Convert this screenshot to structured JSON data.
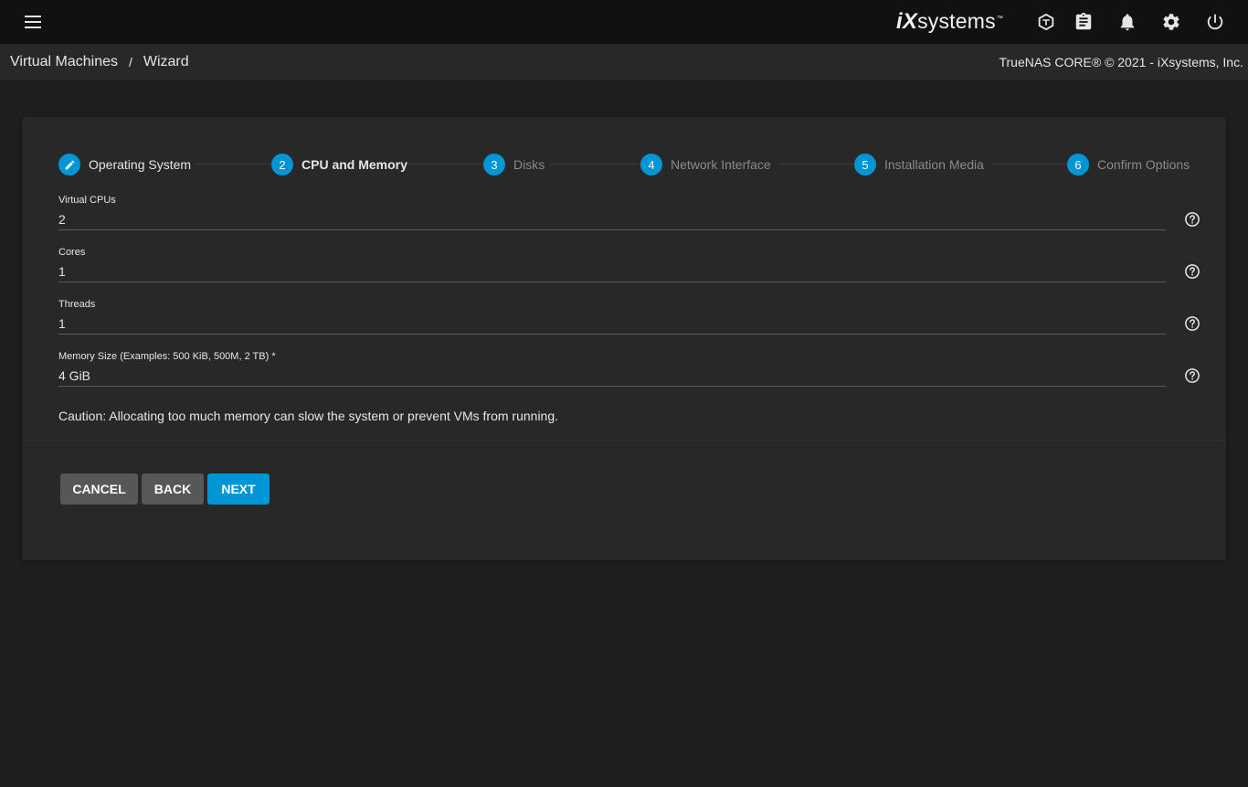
{
  "topbar": {
    "logo_ix": "iX",
    "logo_rest": "systems",
    "logo_tm": "™",
    "icons": [
      "truecommand-icon",
      "clipboard-icon",
      "bell-icon",
      "gear-icon",
      "power-icon"
    ]
  },
  "breadcrumb": {
    "parent": "Virtual Machines",
    "separator": "/",
    "current": "Wizard"
  },
  "copyright": "TrueNAS CORE® © 2021 - iXsystems, Inc.",
  "stepper": {
    "steps": [
      {
        "number": "",
        "label": "Operating System",
        "state": "done"
      },
      {
        "number": "2",
        "label": "CPU and Memory",
        "state": "active"
      },
      {
        "number": "3",
        "label": "Disks",
        "state": "pending"
      },
      {
        "number": "4",
        "label": "Network Interface",
        "state": "pending"
      },
      {
        "number": "5",
        "label": "Installation Media",
        "state": "pending"
      },
      {
        "number": "6",
        "label": "Confirm Options",
        "state": "pending"
      }
    ]
  },
  "form": {
    "vcpus": {
      "label": "Virtual CPUs",
      "value": "2"
    },
    "cores": {
      "label": "Cores",
      "value": "1"
    },
    "threads": {
      "label": "Threads",
      "value": "1"
    },
    "memory": {
      "label": "Memory Size (Examples: 500 KiB, 500M, 2 TB) *",
      "value": "4 GiB"
    },
    "caution": "Caution: Allocating too much memory can slow the system or prevent VMs from running."
  },
  "buttons": {
    "cancel": "CANCEL",
    "back": "BACK",
    "next": "NEXT"
  },
  "colors": {
    "accent": "#0095d5",
    "topbar": "#111111",
    "card": "#282828",
    "background": "#1e1e1e"
  }
}
